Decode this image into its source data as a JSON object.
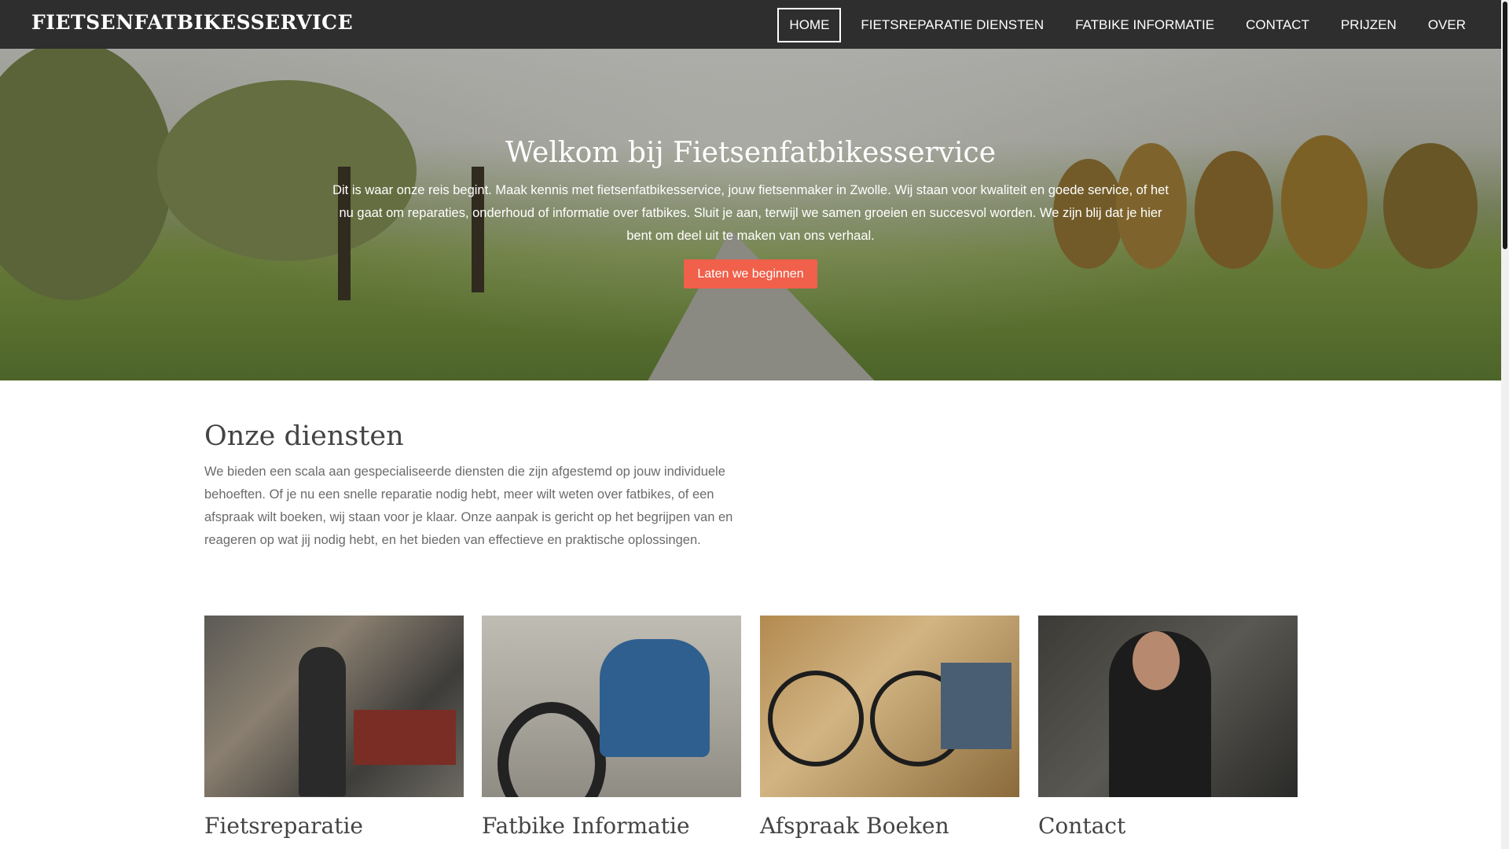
{
  "brand": "FIETSENFATBIKESSERVICE",
  "nav": {
    "items": [
      {
        "label": "HOME",
        "active": true
      },
      {
        "label": "FIETSREPARATIE DIENSTEN",
        "active": false
      },
      {
        "label": "FATBIKE INFORMATIE",
        "active": false
      },
      {
        "label": "CONTACT",
        "active": false
      },
      {
        "label": "PRIJZEN",
        "active": false
      },
      {
        "label": "OVER",
        "active": false
      }
    ]
  },
  "hero": {
    "title": "Welkom bij Fietsenfatbikesservice",
    "text": "Dit is waar onze reis begint. Maak kennis met fietsenfatbikesservice, jouw fietsenmaker in Zwolle. Wij staan voor kwaliteit en goede service, of het nu gaat om reparaties, onderhoud of informatie over fatbikes. Sluit je aan, terwijl we samen groeien en succesvol worden. We zijn blij dat je hier bent om deel uit te maken van ons verhaal.",
    "button_label": "Laten we beginnen"
  },
  "services": {
    "title": "Onze diensten",
    "text": "We bieden een scala aan gespecialiseerde diensten die zijn afgestemd op jouw individuele behoeften. Of je nu een snelle reparatie nodig hebt, meer wilt weten over fatbikes, of een afspraak wilt boeken, wij staan voor je klaar. Onze aanpak is gericht op het begrijpen van en reageren op wat jij nodig hebt, en het bieden van effectieve en praktische oplossingen.",
    "cards": [
      {
        "title": "Fietsreparatie"
      },
      {
        "title": "Fatbike Informatie"
      },
      {
        "title": "Afspraak Boeken"
      },
      {
        "title": "Contact"
      }
    ]
  },
  "colors": {
    "nav_bg": "#2e2e2e",
    "accent_button": "#f0604a",
    "heading_text": "#444444",
    "body_text": "#6b6b6b"
  }
}
